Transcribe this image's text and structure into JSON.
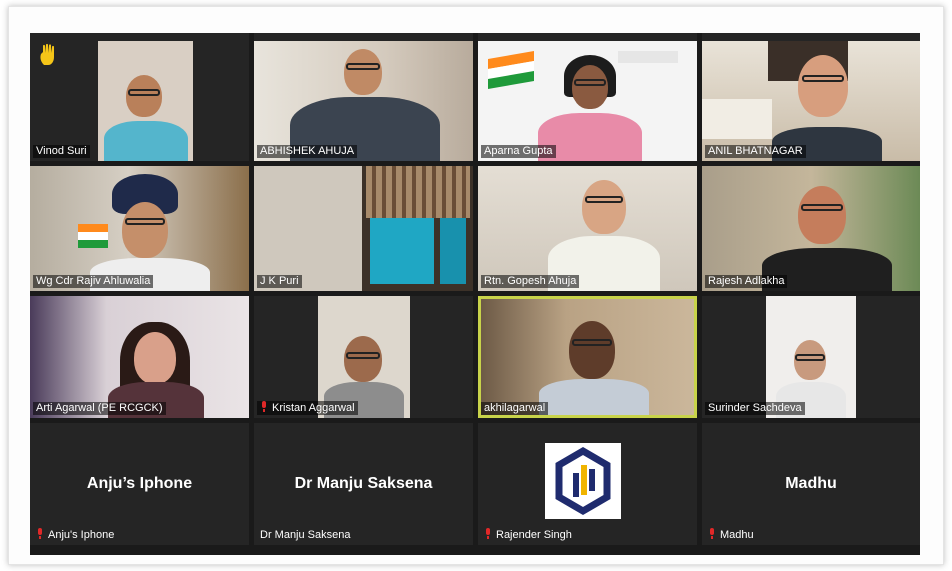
{
  "participants": [
    {
      "name": "Vinod Suri",
      "muted": false,
      "raised_hand": true
    },
    {
      "name": "ABHISHEK AHUJA",
      "muted": false
    },
    {
      "name": "Aparna Gupta",
      "muted": false
    },
    {
      "name": "ANIL BHATNAGAR",
      "muted": false
    },
    {
      "name": "Wg Cdr Rajiv Ahluwalia",
      "muted": false
    },
    {
      "name": "J K Puri",
      "muted": false
    },
    {
      "name": "Rtn. Gopesh Ahuja",
      "muted": false
    },
    {
      "name": "Rajesh Adlakha",
      "muted": false
    },
    {
      "name": "Arti Agarwal (PE RCGCK)",
      "muted": false
    },
    {
      "name": "Kristan Aggarwal",
      "muted": true
    },
    {
      "name": "akhilagarwal",
      "muted": false,
      "active_speaker": true
    },
    {
      "name": "Surinder Sachdeva",
      "muted": false
    },
    {
      "name": "Anju's Iphone",
      "display": "Anju’s Iphone",
      "muted": true
    },
    {
      "name": "Dr Manju Saksena",
      "display": "Dr Manju Saksena",
      "muted": false
    },
    {
      "name": "Rajender Singh",
      "muted": true
    },
    {
      "name": "Madhu",
      "display": "Madhu",
      "muted": true
    }
  ],
  "colors": {
    "background": "#1a1a1a",
    "tile": "#252525",
    "active_border": "#c8d34a",
    "mute": "#e02828"
  },
  "icons": {
    "raised_hand": "hand-icon",
    "muted": "muted-mic-icon"
  }
}
